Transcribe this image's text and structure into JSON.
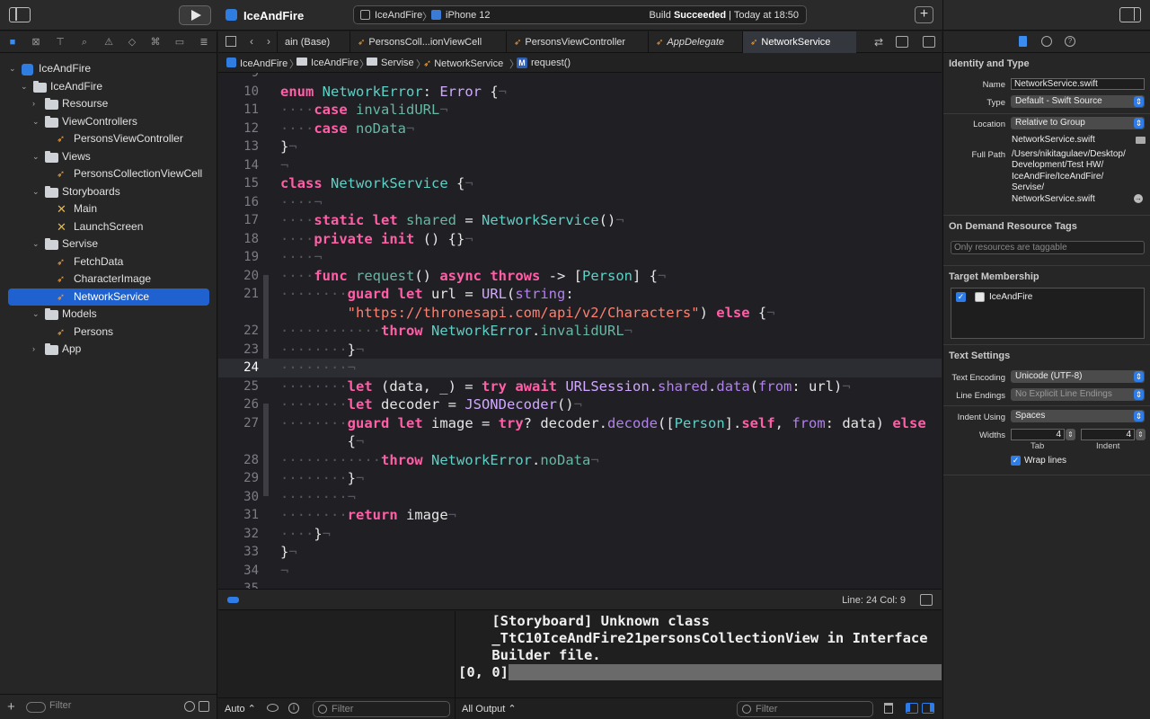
{
  "toolbar": {
    "project_title": "IceAndFire",
    "scheme": "IceAndFire",
    "scheme_separator": "〉",
    "device": "iPhone 12",
    "build_status_prefix": "Build ",
    "build_status_bold": "Succeeded",
    "build_status_suffix": " | Today at 18:50"
  },
  "navigator": {
    "filter_placeholder": "Filter",
    "tree": [
      {
        "label": "IceAndFire",
        "icon": "project-icon",
        "depth": 0,
        "disclosure": "open"
      },
      {
        "label": "IceAndFire",
        "icon": "folder-icon",
        "depth": 1,
        "disclosure": "open"
      },
      {
        "label": "Resourse",
        "icon": "folder-icon",
        "depth": 2,
        "disclosure": "closed"
      },
      {
        "label": "ViewControllers",
        "icon": "folder-icon",
        "depth": 2,
        "disclosure": "open"
      },
      {
        "label": "PersonsViewController",
        "icon": "swift-file-icon",
        "depth": 3,
        "disclosure": ""
      },
      {
        "label": "Views",
        "icon": "folder-icon",
        "depth": 2,
        "disclosure": "open"
      },
      {
        "label": "PersonsCollectionViewCell",
        "icon": "swift-file-icon",
        "depth": 3,
        "disclosure": ""
      },
      {
        "label": "Storyboards",
        "icon": "folder-icon",
        "depth": 2,
        "disclosure": "open"
      },
      {
        "label": "Main",
        "icon": "storyboard-icon",
        "depth": 3,
        "disclosure": ""
      },
      {
        "label": "LaunchScreen",
        "icon": "storyboard-icon",
        "depth": 3,
        "disclosure": ""
      },
      {
        "label": "Servise",
        "icon": "folder-icon",
        "depth": 2,
        "disclosure": "open"
      },
      {
        "label": "FetchData",
        "icon": "swift-file-icon",
        "depth": 3,
        "disclosure": ""
      },
      {
        "label": "CharacterImage",
        "icon": "swift-file-icon",
        "depth": 3,
        "disclosure": ""
      },
      {
        "label": "NetworkService",
        "icon": "swift-file-icon",
        "depth": 3,
        "disclosure": "",
        "selected": true
      },
      {
        "label": "Models",
        "icon": "folder-icon",
        "depth": 2,
        "disclosure": "open"
      },
      {
        "label": "Persons",
        "icon": "swift-file-icon",
        "depth": 3,
        "disclosure": ""
      },
      {
        "label": "App",
        "icon": "folder-icon",
        "depth": 2,
        "disclosure": "closed"
      }
    ]
  },
  "editor": {
    "tabs": [
      {
        "label": "ain (Base)",
        "icon": "",
        "italic": false
      },
      {
        "label": "PersonsColl...ionViewCell",
        "icon": "swift",
        "italic": false
      },
      {
        "label": "PersonsViewController",
        "icon": "swift",
        "italic": false
      },
      {
        "label": "AppDelegate",
        "icon": "swift",
        "italic": true
      },
      {
        "label": "NetworkService",
        "icon": "swift",
        "italic": false,
        "active": true
      }
    ],
    "jumpbar": [
      "IceAndFire",
      "IceAndFire",
      "Servise",
      "NetworkService",
      "request()"
    ],
    "jumpbar_separator": "〉",
    "current_line": 24,
    "lines": [
      {
        "n": "9",
        "html": ""
      },
      {
        "n": "10",
        "html": "<span class='kw'>enum</span> <span class='ty'>NetworkError</span>: <span class='pl'>Error</span> {<span class='ws'>¬</span>"
      },
      {
        "n": "11",
        "html": "<span class='ws'>····</span><span class='kw'>case</span> <span class='fn'>invalidURL</span><span class='ws'>¬</span>"
      },
      {
        "n": "12",
        "html": "<span class='ws'>····</span><span class='kw'>case</span> <span class='fn'>noData</span><span class='ws'>¬</span>"
      },
      {
        "n": "13",
        "html": "}<span class='ws'>¬</span>"
      },
      {
        "n": "14",
        "html": "<span class='ws'>¬</span>"
      },
      {
        "n": "15",
        "html": "<span class='kw'>class</span> <span class='ty'>NetworkService</span> {<span class='ws'>¬</span>"
      },
      {
        "n": "16",
        "html": "<span class='ws'>····¬</span>"
      },
      {
        "n": "17",
        "html": "<span class='ws'>····</span><span class='kw'>static</span> <span class='kw'>let</span> <span class='fn'>shared</span> = <span class='ty'>NetworkService</span>()<span class='ws'>¬</span>"
      },
      {
        "n": "18",
        "html": "<span class='ws'>····</span><span class='kw'>private</span> <span class='kw'>init</span> () {}<span class='ws'>¬</span>"
      },
      {
        "n": "19",
        "html": "<span class='ws'>····¬</span>"
      },
      {
        "n": "20",
        "html": "<span class='ws'>····</span><span class='kw'>func</span> <span class='fn'>request</span>() <span class='kw'>async</span> <span class='kw'>throws</span> -> [<span class='ty'>Person</span>] {<span class='ws'>¬</span>"
      },
      {
        "n": "21",
        "html": "<span class='ws'>········</span><span class='kw'>guard</span> <span class='kw'>let</span> url = <span class='pl'>URL</span>(<span class='pr'>string</span>:"
      },
      {
        "n": "",
        "html": "<span class='ws'>    </span>    <span class='st'>\"https://thronesapi.com/api/v2/Characters\"</span>) <span class='kw'>else</span> {<span class='ws'>¬</span>"
      },
      {
        "n": "22",
        "html": "<span class='ws'>············</span><span class='kw'>throw</span> <span class='ty'>NetworkError</span>.<span class='fn'>invalidURL</span><span class='ws'>¬</span>"
      },
      {
        "n": "23",
        "html": "<span class='ws'>········</span>}<span class='ws'>¬</span>"
      },
      {
        "n": "24",
        "html": "<span class='ws'>········¬</span>"
      },
      {
        "n": "25",
        "html": "<span class='ws'>········</span><span class='kw'>let</span> (data, _) = <span class='kw'>try</span> <span class='kw'>await</span> <span class='pl'>URLSession</span>.<span class='pr'>shared</span>.<span class='pr'>data</span>(<span class='pr'>from</span>: url)<span class='ws'>¬</span>"
      },
      {
        "n": "26",
        "html": "<span class='ws'>········</span><span class='kw'>let</span> decoder = <span class='pl'>JSONDecoder</span>()<span class='ws'>¬</span>"
      },
      {
        "n": "27",
        "html": "<span class='ws'>········</span><span class='kw'>guard</span> <span class='kw'>let</span> image = <span class='kw'>try</span>? decoder.<span class='pr'>decode</span>([<span class='ty'>Person</span>].<span class='kw'>self</span>, <span class='pr'>from</span>: data) <span class='kw'>else</span>"
      },
      {
        "n": "",
        "html": "<span class='ws'>    </span>    {<span class='ws'>¬</span>"
      },
      {
        "n": "28",
        "html": "<span class='ws'>············</span><span class='kw'>throw</span> <span class='ty'>NetworkError</span>.<span class='fn'>noData</span><span class='ws'>¬</span>"
      },
      {
        "n": "29",
        "html": "<span class='ws'>········</span>}<span class='ws'>¬</span>"
      },
      {
        "n": "30",
        "html": "<span class='ws'>········¬</span>"
      },
      {
        "n": "31",
        "html": "<span class='ws'>········</span><span class='kw'>return</span> image<span class='ws'>¬</span>"
      },
      {
        "n": "32",
        "html": "<span class='ws'>····</span>}<span class='ws'>¬</span>"
      },
      {
        "n": "33",
        "html": "}<span class='ws'>¬</span>"
      },
      {
        "n": "34",
        "html": "<span class='ws'>¬</span>"
      },
      {
        "n": "35",
        "html": ""
      }
    ],
    "status_position": "Line: 24  Col: 9"
  },
  "debug": {
    "console_lines": [
      "    [Storyboard] Unknown class",
      "    _TtC10IceAndFire21personsCollectionView in Interface",
      "    Builder file.",
      "[0, 0]"
    ],
    "auto_label": "Auto ⌃",
    "left_filter_placeholder": "Filter",
    "output_label": "All Output ⌃",
    "right_filter_placeholder": "Filter"
  },
  "inspector": {
    "identity_title": "Identity and Type",
    "name_label": "Name",
    "name_value": "NetworkService.swift",
    "type_label": "Type",
    "type_value": "Default - Swift Source",
    "location_label": "Location",
    "location_value": "Relative to Group",
    "location_file": "NetworkService.swift",
    "full_path_label": "Full Path",
    "full_path_lines": [
      "/Users/nikitagulaev/Desktop/",
      "Development/Test HW/",
      "IceAndFire/IceAndFire/",
      "Servise/",
      "NetworkService.swift"
    ],
    "odr_title": "On Demand Resource Tags",
    "odr_placeholder": "Only resources are taggable",
    "target_title": "Target Membership",
    "target_name": "IceAndFire",
    "text_settings_title": "Text Settings",
    "encoding_label": "Text Encoding",
    "encoding_value": "Unicode (UTF-8)",
    "line_endings_label": "Line Endings",
    "line_endings_value": "No Explicit Line Endings",
    "indent_using_label": "Indent Using",
    "indent_using_value": "Spaces",
    "widths_label": "Widths",
    "tab_width": "4",
    "indent_width": "4",
    "tab_sub": "Tab",
    "indent_sub": "Indent",
    "wrap_label": "Wrap lines"
  }
}
